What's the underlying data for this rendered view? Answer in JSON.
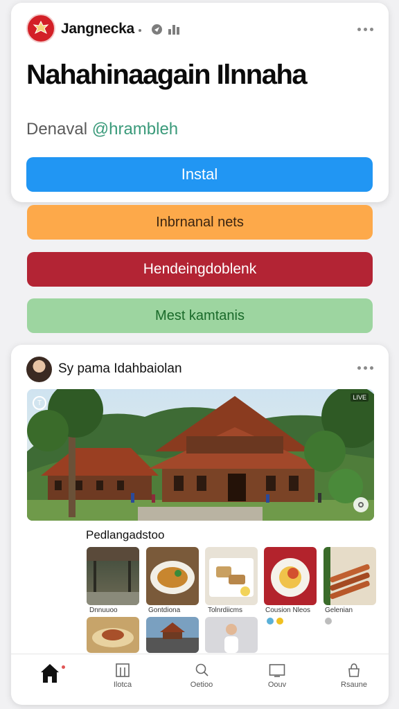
{
  "app": {
    "name": "Jangnecka",
    "headline": "Nahahinaagain Ilnnaha",
    "developer_prefix": "Denaval ",
    "developer_handle": "@hrambleh",
    "install_label": "Instal"
  },
  "categories": [
    {
      "label": "Inbrnanal nets",
      "color": "#fda94a"
    },
    {
      "label": "Hendeingdoblenk",
      "color": "#b32434"
    },
    {
      "label": "Mest kamtanis",
      "color": "#9dd5a0"
    }
  ],
  "post": {
    "author": "Sy pama Idahbaiolan",
    "hero_badge_right": "LIVE",
    "section_label": "Pedlangadstoo",
    "thumbnails": [
      {
        "caption": "Dnnuuoo",
        "icon": "hall-photo"
      },
      {
        "caption": "Gontdiona",
        "icon": "noodle-plate"
      },
      {
        "caption": "Tolnrdiicms",
        "icon": "rolled-dish"
      },
      {
        "caption": "Cousion Nleos",
        "icon": "egg-dish"
      },
      {
        "caption": "Gelenian",
        "icon": "satay-skewers"
      },
      {
        "caption": "",
        "icon": "food-platter"
      },
      {
        "caption": "",
        "icon": "road-house"
      },
      {
        "caption": "",
        "icon": "person-portrait"
      }
    ]
  },
  "nav": [
    {
      "label": "",
      "icon": "home-icon"
    },
    {
      "label": "Ilotca",
      "icon": "frame-icon"
    },
    {
      "label": "Oetioo",
      "icon": "search-icon"
    },
    {
      "label": "Oouv",
      "icon": "tv-icon"
    },
    {
      "label": "Rsaune",
      "icon": "bag-icon"
    }
  ],
  "colors": {
    "install": "#2196f3",
    "accent_red": "#b32434",
    "accent_orange": "#fda94a",
    "accent_green": "#9dd5a0"
  }
}
